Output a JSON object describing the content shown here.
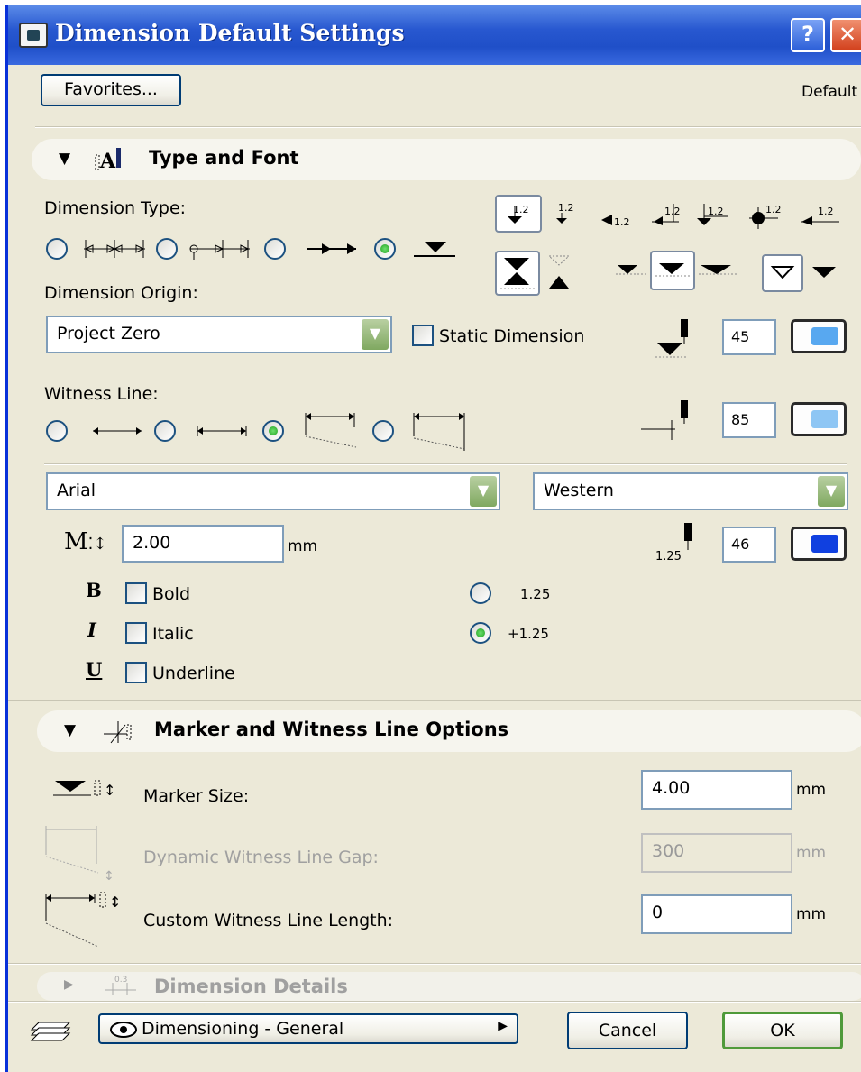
{
  "window": {
    "title": "Dimension Default Settings",
    "help": "?",
    "close": "✕"
  },
  "toolbar": {
    "favorites_label": "Favorites...",
    "default_label": "Default"
  },
  "type_font": {
    "section_label": "Type and Font",
    "dimension_type_label": "Dimension Type:",
    "dimension_origin_label": "Dimension Origin:",
    "origin_value": "Project Zero",
    "static_dimension_label": "Static Dimension",
    "witness_line_label": "Witness Line:",
    "pen1": "45",
    "pen2": "85",
    "pen3": "46",
    "font_value": "Arial",
    "script_value": "Western",
    "text_size": "2.00",
    "text_size_unit": "mm",
    "bold_label": "Bold",
    "italic_label": "Italic",
    "underline_label": "Underline",
    "bold_glyph": "B",
    "italic_glyph": "I",
    "underline_glyph": "U",
    "number_format_1": "1.25",
    "number_format_2": "+1.25",
    "marker_sample_1": "1.2",
    "pen_sample_label": "1.25",
    "size_glyph": "M"
  },
  "marker_options": {
    "section_label": "Marker and Witness Line Options",
    "marker_size_label": "Marker Size:",
    "marker_size_value": "4.00",
    "gap_label": "Dynamic Witness Line Gap:",
    "gap_value": "300",
    "length_label": "Custom Witness Line Length:",
    "length_value": "0",
    "unit": "mm"
  },
  "details": {
    "section_label": "Dimension Details"
  },
  "footer": {
    "layer_value": "Dimensioning - General",
    "cancel_label": "Cancel",
    "ok_label": "OK"
  },
  "colors": {
    "titlebar": "#245edb",
    "dialog": "#ece9d8",
    "pen_blue": "#1040e0",
    "pen_light": "#58a8f0"
  }
}
